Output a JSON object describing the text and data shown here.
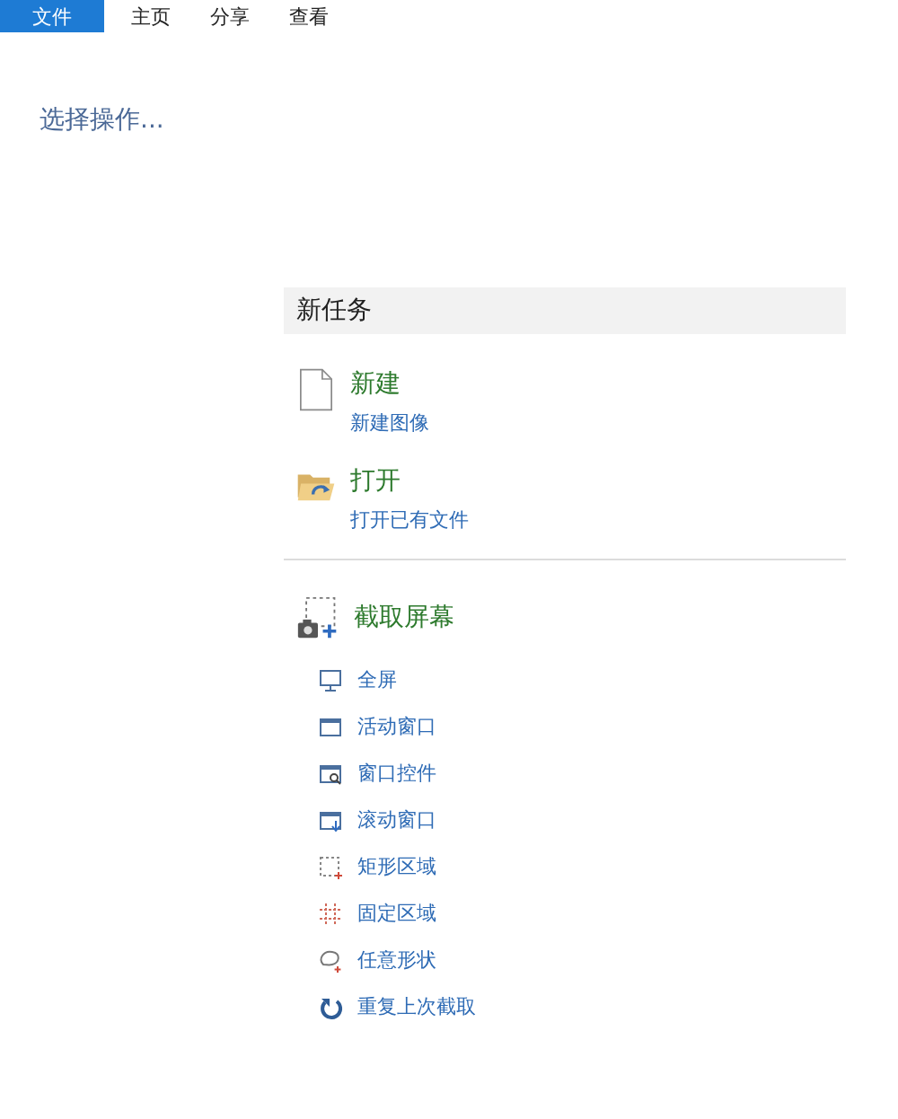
{
  "menu": [
    {
      "label": "文件",
      "selected": true
    },
    {
      "label": "主页",
      "selected": false
    },
    {
      "label": "分享",
      "selected": false
    },
    {
      "label": "查看",
      "selected": false
    }
  ],
  "heading": "选择操作...",
  "panel": {
    "title": "新任务",
    "tasks": [
      {
        "kind": "new",
        "title": "新建",
        "subtitle": "新建图像"
      },
      {
        "kind": "open",
        "title": "打开",
        "subtitle": "打开已有文件"
      }
    ],
    "capture": {
      "title": "截取屏幕",
      "items": [
        {
          "kind": "fullscreen",
          "label": "全屏"
        },
        {
          "kind": "window",
          "label": "活动窗口"
        },
        {
          "kind": "control",
          "label": "窗口控件"
        },
        {
          "kind": "scroll",
          "label": "滚动窗口"
        },
        {
          "kind": "rect",
          "label": "矩形区域"
        },
        {
          "kind": "fixed",
          "label": "固定区域"
        },
        {
          "kind": "freeform",
          "label": "任意形状"
        },
        {
          "kind": "repeat",
          "label": "重复上次截取"
        }
      ]
    }
  }
}
